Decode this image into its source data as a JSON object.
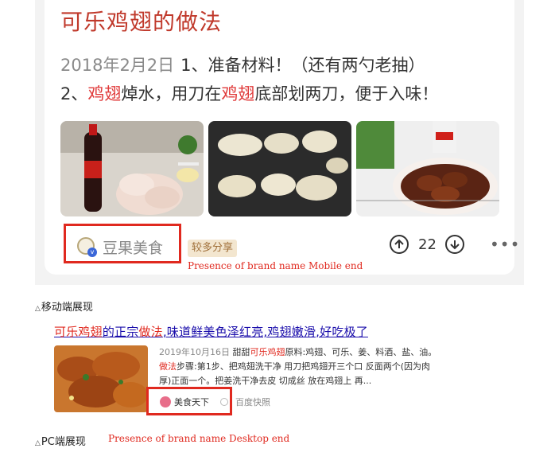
{
  "mobile": {
    "title": "可乐鸡翅的做法",
    "date": "2018年2月2日",
    "step1": "1、准备材料！（还有两勺老抽）",
    "step2_pre": "2、",
    "step2_hl1": "鸡翅",
    "step2_mid": "焯水，用刀在",
    "step2_hl2": "鸡翅",
    "step2_post": "底部划两刀，便于入味！",
    "brand_name": "豆果美食",
    "share_badge": "较多分享",
    "upvotes": "22",
    "more_glyph": "•••",
    "brand_caption": "Presence of brand name Mobile end"
  },
  "section_mobile_label": "移动端展现",
  "section_pc_label": "PC端展现",
  "pc": {
    "title_em1": "可乐鸡翅",
    "title_mid1": "的正宗",
    "title_em2": "做法",
    "title_rest": ",味道鲜美色泽红亮,鸡翅嫩滑,好吃极了",
    "line1_date": "2019年10月16日",
    "line1_pre": " 甜甜",
    "line1_em": "可乐鸡翅",
    "line1_post": "原料:鸡翅、可乐、姜、料酒、盐、油。",
    "line2_em": "做法",
    "line2_post": "步骤:第1步、把鸡翅洗干净 用刀把鸡翅开三个口 反面两个(因为肉",
    "line3": "厚)正面一个。把姜洗干净去皮 切成丝 放在鸡翅上 再...",
    "source_name": "美食天下",
    "snapshot": "百度快照",
    "brand_caption": "Presence of brand name Desktop end"
  },
  "colors": {
    "brand_red": "#e0291f",
    "link_blue": "#1a0dab",
    "highlight_red": "#e03a3a"
  },
  "icons": [
    "up-arrow-icon",
    "down-arrow-icon",
    "more-icon",
    "brand-logo-icon",
    "verified-icon",
    "source-logo-icon"
  ]
}
